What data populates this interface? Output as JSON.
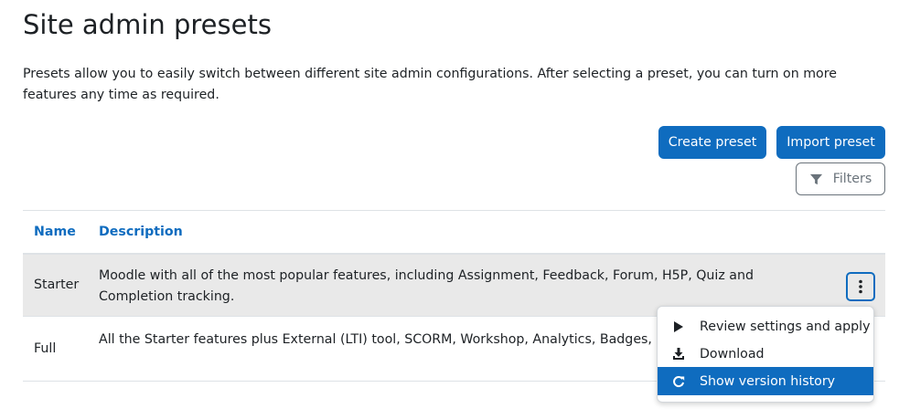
{
  "page": {
    "title": "Site admin presets",
    "intro": "Presets allow you to easily switch between different site admin configurations. After selecting a preset, you can turn on more features any time as required."
  },
  "actions": {
    "create_label": "Create preset",
    "import_label": "Import preset",
    "filters_label": "Filters"
  },
  "table": {
    "headers": {
      "name": "Name",
      "description": "Description"
    },
    "rows": [
      {
        "name": "Starter",
        "description": "Moodle with all of the most popular features, including Assignment, Feedback, Forum, H5P, Quiz and Completion tracking."
      },
      {
        "name": "Full",
        "description": "All the Starter features plus External (LTI) tool, SCORM, Workshop, Analytics, Badges, Comp and lots more."
      }
    ]
  },
  "action_menu": {
    "items": [
      {
        "label": "Review settings and apply",
        "icon": "play-icon"
      },
      {
        "label": "Download",
        "icon": "download-icon"
      },
      {
        "label": "Show version history",
        "icon": "history-icon"
      }
    ]
  },
  "colors": {
    "primary": "#0f6cbf",
    "row_highlight": "#e9e9e9",
    "text": "#1d2125",
    "muted": "#6a737b"
  }
}
